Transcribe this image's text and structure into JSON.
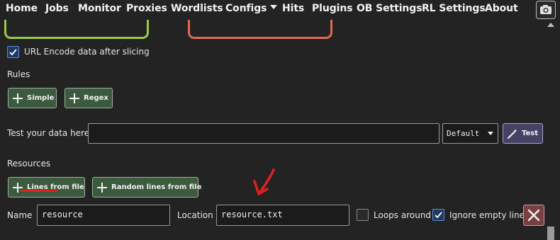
{
  "nav": {
    "items": [
      {
        "label": "Home"
      },
      {
        "label": "Jobs"
      },
      {
        "label": "Monitor"
      },
      {
        "label": "Proxies"
      },
      {
        "label": "Wordlists"
      },
      {
        "label": "Configs"
      },
      {
        "label": "Hits"
      },
      {
        "label": "Plugins"
      },
      {
        "label": "OB Settings"
      },
      {
        "label": "RL Settings"
      },
      {
        "label": "About"
      }
    ],
    "camera_icon": "camera-icon",
    "highlight_colors": {
      "green": "#9cc94a",
      "orange": "#e06a4e"
    }
  },
  "url_encode": {
    "label": "URL Encode data after slicing",
    "checked": true
  },
  "rules": {
    "title": "Rules",
    "simple_button": "Simple",
    "regex_button": "Regex"
  },
  "test": {
    "label": "Test your data here:",
    "input_value": "",
    "mode_selected": "Default",
    "test_button": "Test"
  },
  "resources": {
    "title": "Resources",
    "lines_from_file_button": "Lines from file",
    "random_lines_button": "Random lines from file",
    "name_label": "Name",
    "name_value": "resource",
    "location_label": "Location",
    "location_value": "resource.txt",
    "loops_around_label": "Loops around",
    "loops_around_checked": false,
    "ignore_empty_label": "Ignore empty lines",
    "ignore_empty_checked": true,
    "annotation_color": "#e02020"
  },
  "colors": {
    "background": "#232323",
    "green_button": "#3c5a3d",
    "test_button": "#454266",
    "delete_button": "#7a4040"
  }
}
